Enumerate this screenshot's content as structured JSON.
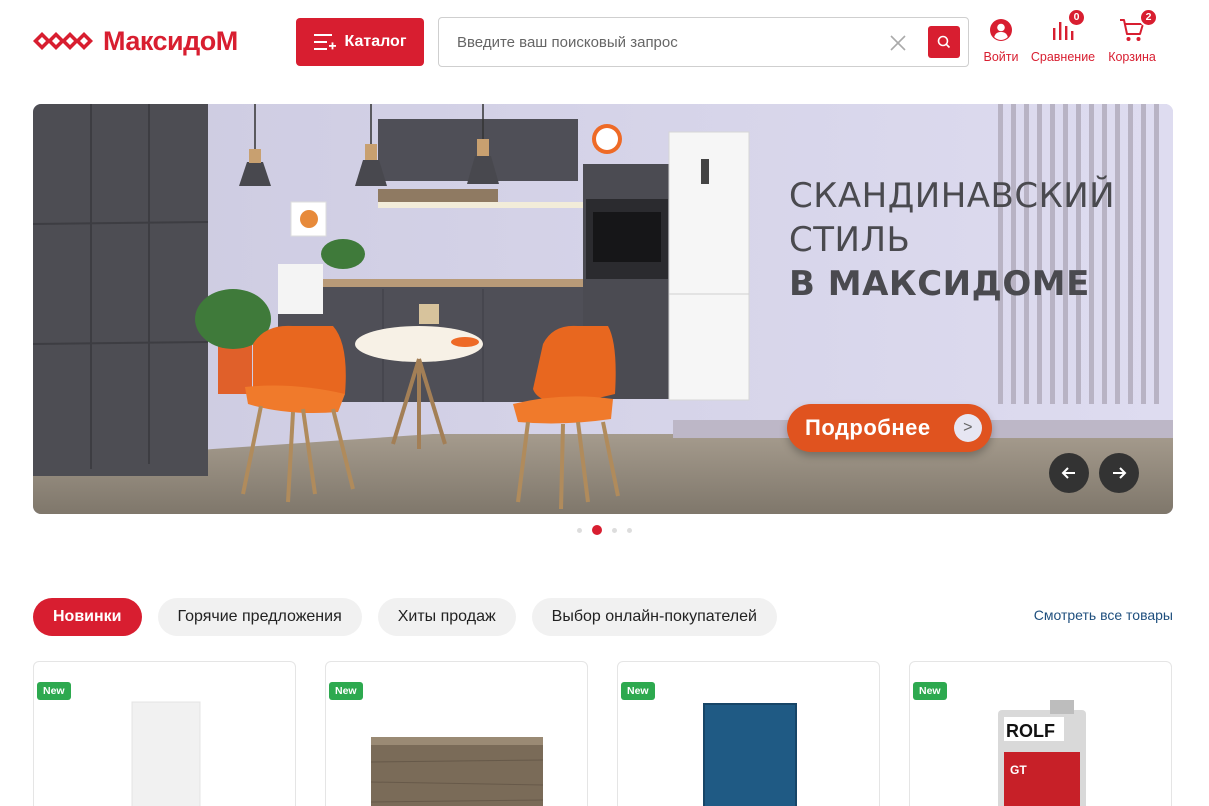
{
  "header": {
    "logo_text": "МаксидоМ",
    "catalog_label": "Каталог",
    "search_placeholder": "Введите ваш поисковый запрос",
    "login_label": "Войти",
    "compare_label": "Сравнение",
    "compare_count": "0",
    "cart_label": "Корзина",
    "cart_count": "2"
  },
  "banner": {
    "line1": "СКАНДИНАВСКИЙ",
    "line2": "СТИЛЬ",
    "line3": "В МАКСИДОМЕ",
    "button_label": "Подробнее",
    "button_arrow": ">"
  },
  "carousel": {
    "slide_count": 4,
    "active_slide": 2
  },
  "products_section": {
    "tabs": [
      {
        "label": "Новинки",
        "active": true
      },
      {
        "label": "Горячие предложения",
        "active": false
      },
      {
        "label": "Хиты продаж",
        "active": false
      },
      {
        "label": "Выбор онлайн-покупателей",
        "active": false
      }
    ],
    "see_all": "Смотреть все товары",
    "cards": [
      {
        "badge": "New",
        "image": "white-panel"
      },
      {
        "badge": "New",
        "image": "wood-laminate"
      },
      {
        "badge": "New",
        "image": "blue-rug"
      },
      {
        "badge": "New",
        "image": "rolf-oil-can"
      }
    ]
  },
  "colors": {
    "brand_red": "#d81e30",
    "button_orange": "#e0531f",
    "badge_green": "#2da94f",
    "link_blue": "#1f4f7e"
  }
}
